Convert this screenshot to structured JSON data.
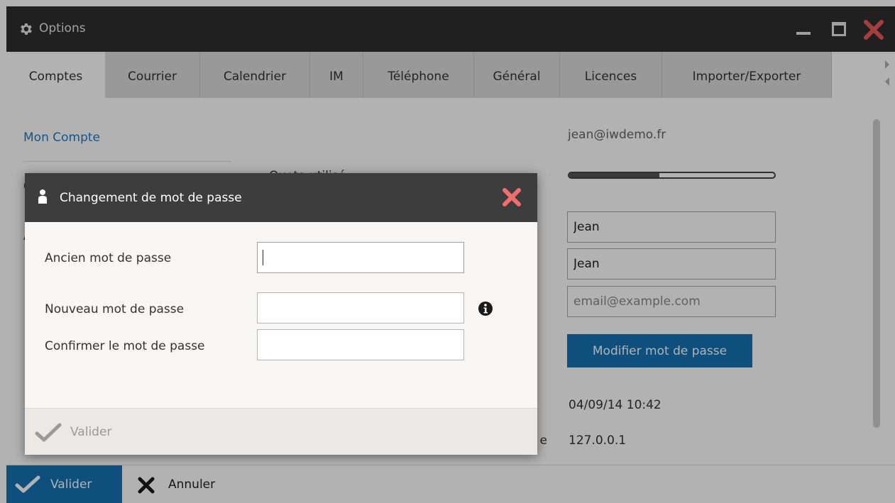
{
  "window": {
    "title": "Options"
  },
  "tabs": [
    {
      "label": "Comptes",
      "active": true
    },
    {
      "label": "Courrier"
    },
    {
      "label": "Calendrier"
    },
    {
      "label": "IM"
    },
    {
      "label": "Téléphone"
    },
    {
      "label": "Général"
    },
    {
      "label": "Licences"
    },
    {
      "label": "Importer/Exporter"
    }
  ],
  "sidebar": {
    "my_account": "Mon Compte",
    "item2": "C",
    "item3": "A"
  },
  "account": {
    "email": "jean@iwdemo.fr",
    "quota_label": "Quota utilisé",
    "quota_fraction": 0.44,
    "first_name": "Jean",
    "last_name": "Jean",
    "alt_email_placeholder": "email@example.com",
    "change_password_label": "Modifier mot de passe",
    "last_login": "04/09/14 10:42",
    "last_ip_label_tail": "e",
    "last_ip": "127.0.0.1"
  },
  "footer": {
    "validate_label": "Valider",
    "cancel_label": "Annuler"
  },
  "dialog": {
    "title": "Changement de mot de passe",
    "old_password_label": "Ancien mot de passe",
    "new_password_label": "Nouveau mot de passe",
    "confirm_password_label": "Confirmer le mot de passe",
    "old_password_value": "",
    "new_password_value": "",
    "confirm_password_value": "",
    "validate_label": "Valider"
  },
  "colors": {
    "accent": "#1571b5",
    "close_red": "#f05a5a",
    "titlebar": "#2f2f2f"
  },
  "icons": {
    "window": "gear-icon",
    "dialog": "user-icon",
    "validate": "checkmark-icon",
    "cancel": "x-icon",
    "info": "info-icon"
  }
}
